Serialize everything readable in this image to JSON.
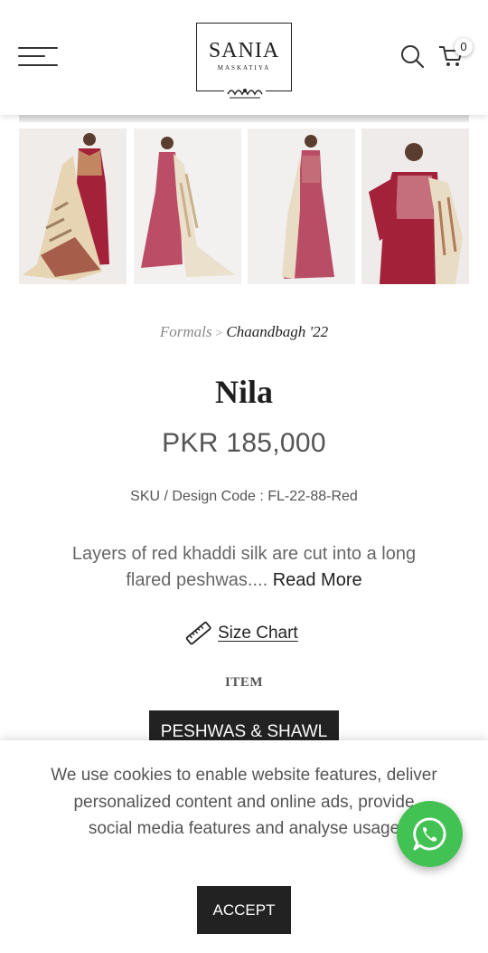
{
  "header": {
    "brand_name": "SANIA",
    "brand_subtitle": "MASKATIYA",
    "menu_icon": "hamburger-icon",
    "search_icon": "search-icon",
    "cart_icon": "cart-icon",
    "cart_count": "0"
  },
  "gallery": {
    "thumbnails": [
      "Nila look 1",
      "Nila look 2",
      "Nila look 3",
      "Nila look 4"
    ]
  },
  "breadcrumb": {
    "parent": "Formals",
    "separator": ">",
    "current": "Chaandbagh '22"
  },
  "product": {
    "title": "Nila",
    "price": "PKR 185,000",
    "sku": "SKU / Design Code : FL-22-88-Red",
    "description": "Layers of red khaddi silk are cut into a long flared peshwas....",
    "read_more": "Read More",
    "size_chart_label": "Size Chart",
    "size_chart_icon": "ruler-icon",
    "item_heading": "ITEM",
    "variant_label": "PESHWAS & SHAWL"
  },
  "cookie_banner": {
    "text": "We use cookies to enable website features, deliver personalized content and online ads, provide social media features and analyse usage",
    "accept_label": "ACCEPT"
  },
  "whatsapp": {
    "icon": "whatsapp-icon",
    "color": "#41c252"
  },
  "colors": {
    "dress_red": "#a3223a",
    "shawl_cream": "#e9dcc4",
    "dark_button": "#222222"
  }
}
